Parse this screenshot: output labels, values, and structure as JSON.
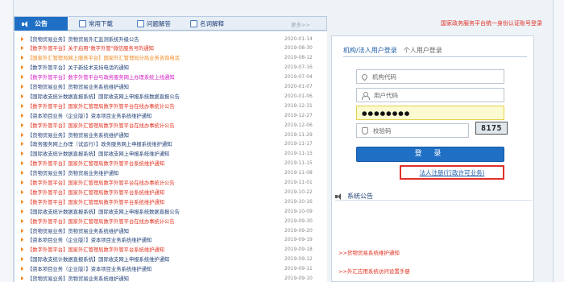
{
  "tabs": {
    "notice": "公告",
    "download": "常用下载",
    "faq": "问题解答",
    "glossary": "名词解释",
    "more": "更多>>"
  },
  "notices": [
    {
      "text": "【货物贸易业务】货物贸易外汇监测系统升级公告",
      "date": "2020-01-14",
      "color": "blue"
    },
    {
      "text": "【数字外管平台】关于启用\"数字外管\"微信服务号的通知",
      "date": "2019-08-30",
      "color": "red"
    },
    {
      "text": "【国家外汇管理局网上服务平台】国家外汇管理局分局业务咨询电话",
      "date": "2019-08-12",
      "color": "orange"
    },
    {
      "text": "【数字外管平台】关于新技术支持电话的通知",
      "date": "2019-07-16",
      "color": "blue"
    },
    {
      "text": "【数字外管平台】数字外管平台与政务服务网上办理系统上线通知",
      "date": "2019-07-04",
      "color": "magenta"
    },
    {
      "text": "【货物贸易业务】货物贸易业务系统维护通知",
      "date": "2020-01-07",
      "color": "blue"
    },
    {
      "text": "【国际收支统计数据直报系统】国际收支网上申报系统数据直报公告",
      "date": "2020-01-06",
      "color": "blue"
    },
    {
      "text": "【数字外管平台】国家外汇管理局数字外管平台在线办事统计公告",
      "date": "2019-12-31",
      "color": "red"
    },
    {
      "text": "【资本项目业务（企业版）】资本项目业务系统维护通知",
      "date": "2019-12-27",
      "color": "blue"
    },
    {
      "text": "【数字外管平台】国家外汇管理局数字外管平台在线办事统计公告",
      "date": "2019-12-06",
      "color": "red"
    },
    {
      "text": "【货物贸易业务】货物贸易业务系统维护通知",
      "date": "2019-11-29",
      "color": "blue"
    },
    {
      "text": "【政务服务网上办理（试运行）】政务服务网上申报系统维护通知",
      "date": "2019-11-17",
      "color": "blue"
    },
    {
      "text": "【国际收支统计数据直报系统】国际收支网上申报系统维护通知",
      "date": "2019-11-15",
      "color": "blue"
    },
    {
      "text": "【数字外管平台】国家外汇管理局数字外管平台系统维护通知",
      "date": "2019-11-15",
      "color": "red"
    },
    {
      "text": "【货物贸易业务】货物贸易业务维护通知",
      "date": "2019-11-08",
      "color": "blue"
    },
    {
      "text": "【数字外管平台】国家外汇管理局数字外管平台在线办事统计公告",
      "date": "2019-11-01",
      "color": "red"
    },
    {
      "text": "【数字外管平台】国家外汇管理局数字外管平台系统维护通知",
      "date": "2019-10-22",
      "color": "red"
    },
    {
      "text": "【数字外管平台】国家外汇管理局数字外管平台系统维护通知",
      "date": "2019-10-16",
      "color": "red"
    },
    {
      "text": "【国际收支统计数据直报系统】国际收支网上申报系统数据直报公告",
      "date": "2019-10-09",
      "color": "blue"
    },
    {
      "text": "【数字外管平台】国家外汇管理局数字外管平台在线办事统计公告",
      "date": "2019-09-30",
      "color": "red"
    },
    {
      "text": "【货物贸易业务】货物贸易业务系统维护通知",
      "date": "2019-09-20",
      "color": "blue"
    },
    {
      "text": "【资本项目业务（企业版）】资本项目业务系统维护通知",
      "date": "2019-09-19",
      "color": "blue"
    },
    {
      "text": "【数字外管平台】国家外汇管理局数字外管平台系统维护通知",
      "date": "2019-09-18",
      "color": "red"
    },
    {
      "text": "【国际收支统计数据直报系统】国际收支网上申报系统维护通知",
      "date": "2019-09-12",
      "color": "blue"
    },
    {
      "text": "【资本项目业务（企业版）】资本项目业务系统维护通知",
      "date": "2019-09-11",
      "color": "blue"
    },
    {
      "text": "【货物贸易业务】货物贸易业务系统维护通知",
      "date": "2019-09-10",
      "color": "blue"
    }
  ],
  "header": {
    "gov_link": "国家政务服务平台统一身份认证账号登录"
  },
  "login": {
    "tab_org": "机构/法人用户登录",
    "tab_personal": "个人用户登录",
    "org_code_placeholder": "机构代码",
    "user_code_placeholder": "用户代码",
    "password_value": "●●●●●●●●",
    "captcha_placeholder": "校验码",
    "captcha_text": "8175",
    "login_button": "登  录",
    "register_link": "法人注册(行政许可业务)"
  },
  "system": {
    "title": "系统公告",
    "items": [
      ">>货物贸易系统维护通知",
      ">>外汇应用系统访问设置手册"
    ]
  },
  "colors": {
    "accent": "#1f6fc5",
    "red": "#e0301e",
    "orange": "#f08a24",
    "magenta": "#d21cc4",
    "link": "#1e3e76"
  }
}
